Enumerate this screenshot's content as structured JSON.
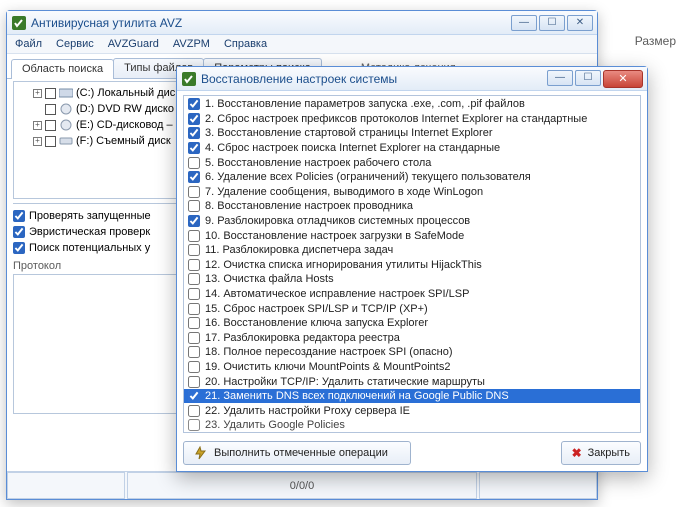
{
  "main": {
    "title": "Антивирусная утилита AVZ",
    "menu": {
      "file": "Файл",
      "service": "Сервис",
      "avzguard": "AVZGuard",
      "avzpm": "AVZPM",
      "help": "Справка"
    },
    "tabs": {
      "search_area": "Область поиска",
      "file_types": "Типы файлов",
      "search_params": "Параметры поиска",
      "treatment": "Методика лечения"
    },
    "drives": [
      {
        "label": "(С:) Локальный дис"
      },
      {
        "label": "(D:) DVD RW диско"
      },
      {
        "label": "(Е:) CD-дисковод –"
      },
      {
        "label": "(F:) Съемный диск"
      }
    ],
    "checks": {
      "running": "Проверять запущенные",
      "heuristic": "Эвристическая проверк",
      "potential": "Поиск потенциальных у"
    },
    "protocol_label": "Протокол",
    "status": "0/0/0",
    "right_fragment": "Размер"
  },
  "dialog": {
    "title": "Восстановление настроек системы",
    "execute_label": "Выполнить отмеченные операции",
    "close_label": "Закрыть",
    "items": [
      {
        "checked": true,
        "text": "1. Восстановление параметров запуска .exe, .com, .pif файлов"
      },
      {
        "checked": true,
        "text": "2. Сброс настроек префиксов протоколов Internet Explorer на стандартные"
      },
      {
        "checked": true,
        "text": "3. Восстановление стартовой страницы Internet Explorer"
      },
      {
        "checked": true,
        "text": "4. Сброс настроек поиска Internet Explorer на стандарные"
      },
      {
        "checked": false,
        "text": "5. Восстановление настроек рабочего стола"
      },
      {
        "checked": true,
        "text": "6. Удаление всех Policies (ограничений) текущего пользователя"
      },
      {
        "checked": false,
        "text": "7. Удаление сообщения, выводимого в ходе WinLogon"
      },
      {
        "checked": false,
        "text": "8. Восстановление настроек проводника"
      },
      {
        "checked": true,
        "text": "9. Разблокировка отладчиков системных процессов"
      },
      {
        "checked": false,
        "text": "10. Восстановление настроек загрузки в SafeMode"
      },
      {
        "checked": false,
        "text": "11. Разблокировка диспетчера задач"
      },
      {
        "checked": false,
        "text": "12. Очистка списка игнорирования утилиты HijackThis"
      },
      {
        "checked": false,
        "text": "13. Очистка файла Hosts"
      },
      {
        "checked": false,
        "text": "14. Автоматическое исправление настроек SPI/LSP"
      },
      {
        "checked": false,
        "text": "15. Сброс настроек SPI/LSP и TCP/IP (XP+)"
      },
      {
        "checked": false,
        "text": "16. Восстановление ключа запуска Explorer"
      },
      {
        "checked": false,
        "text": "17. Разблокировка редактора реестра"
      },
      {
        "checked": false,
        "text": "18. Полное пересоздание настроек SPI (опасно)"
      },
      {
        "checked": false,
        "text": "19. Очистить ключи MountPoints & MountPoints2"
      },
      {
        "checked": false,
        "text": "20. Настройки TCP/IP: Удалить статические маршруты"
      },
      {
        "checked": true,
        "selected": true,
        "text": "21. Заменить DNS всех подключений на Google Public DNS"
      },
      {
        "checked": false,
        "text": "22. Удалить настройки Proxy сервера IE"
      },
      {
        "checked": false,
        "cut": true,
        "text": "23. Удалить Google Policies"
      }
    ]
  }
}
